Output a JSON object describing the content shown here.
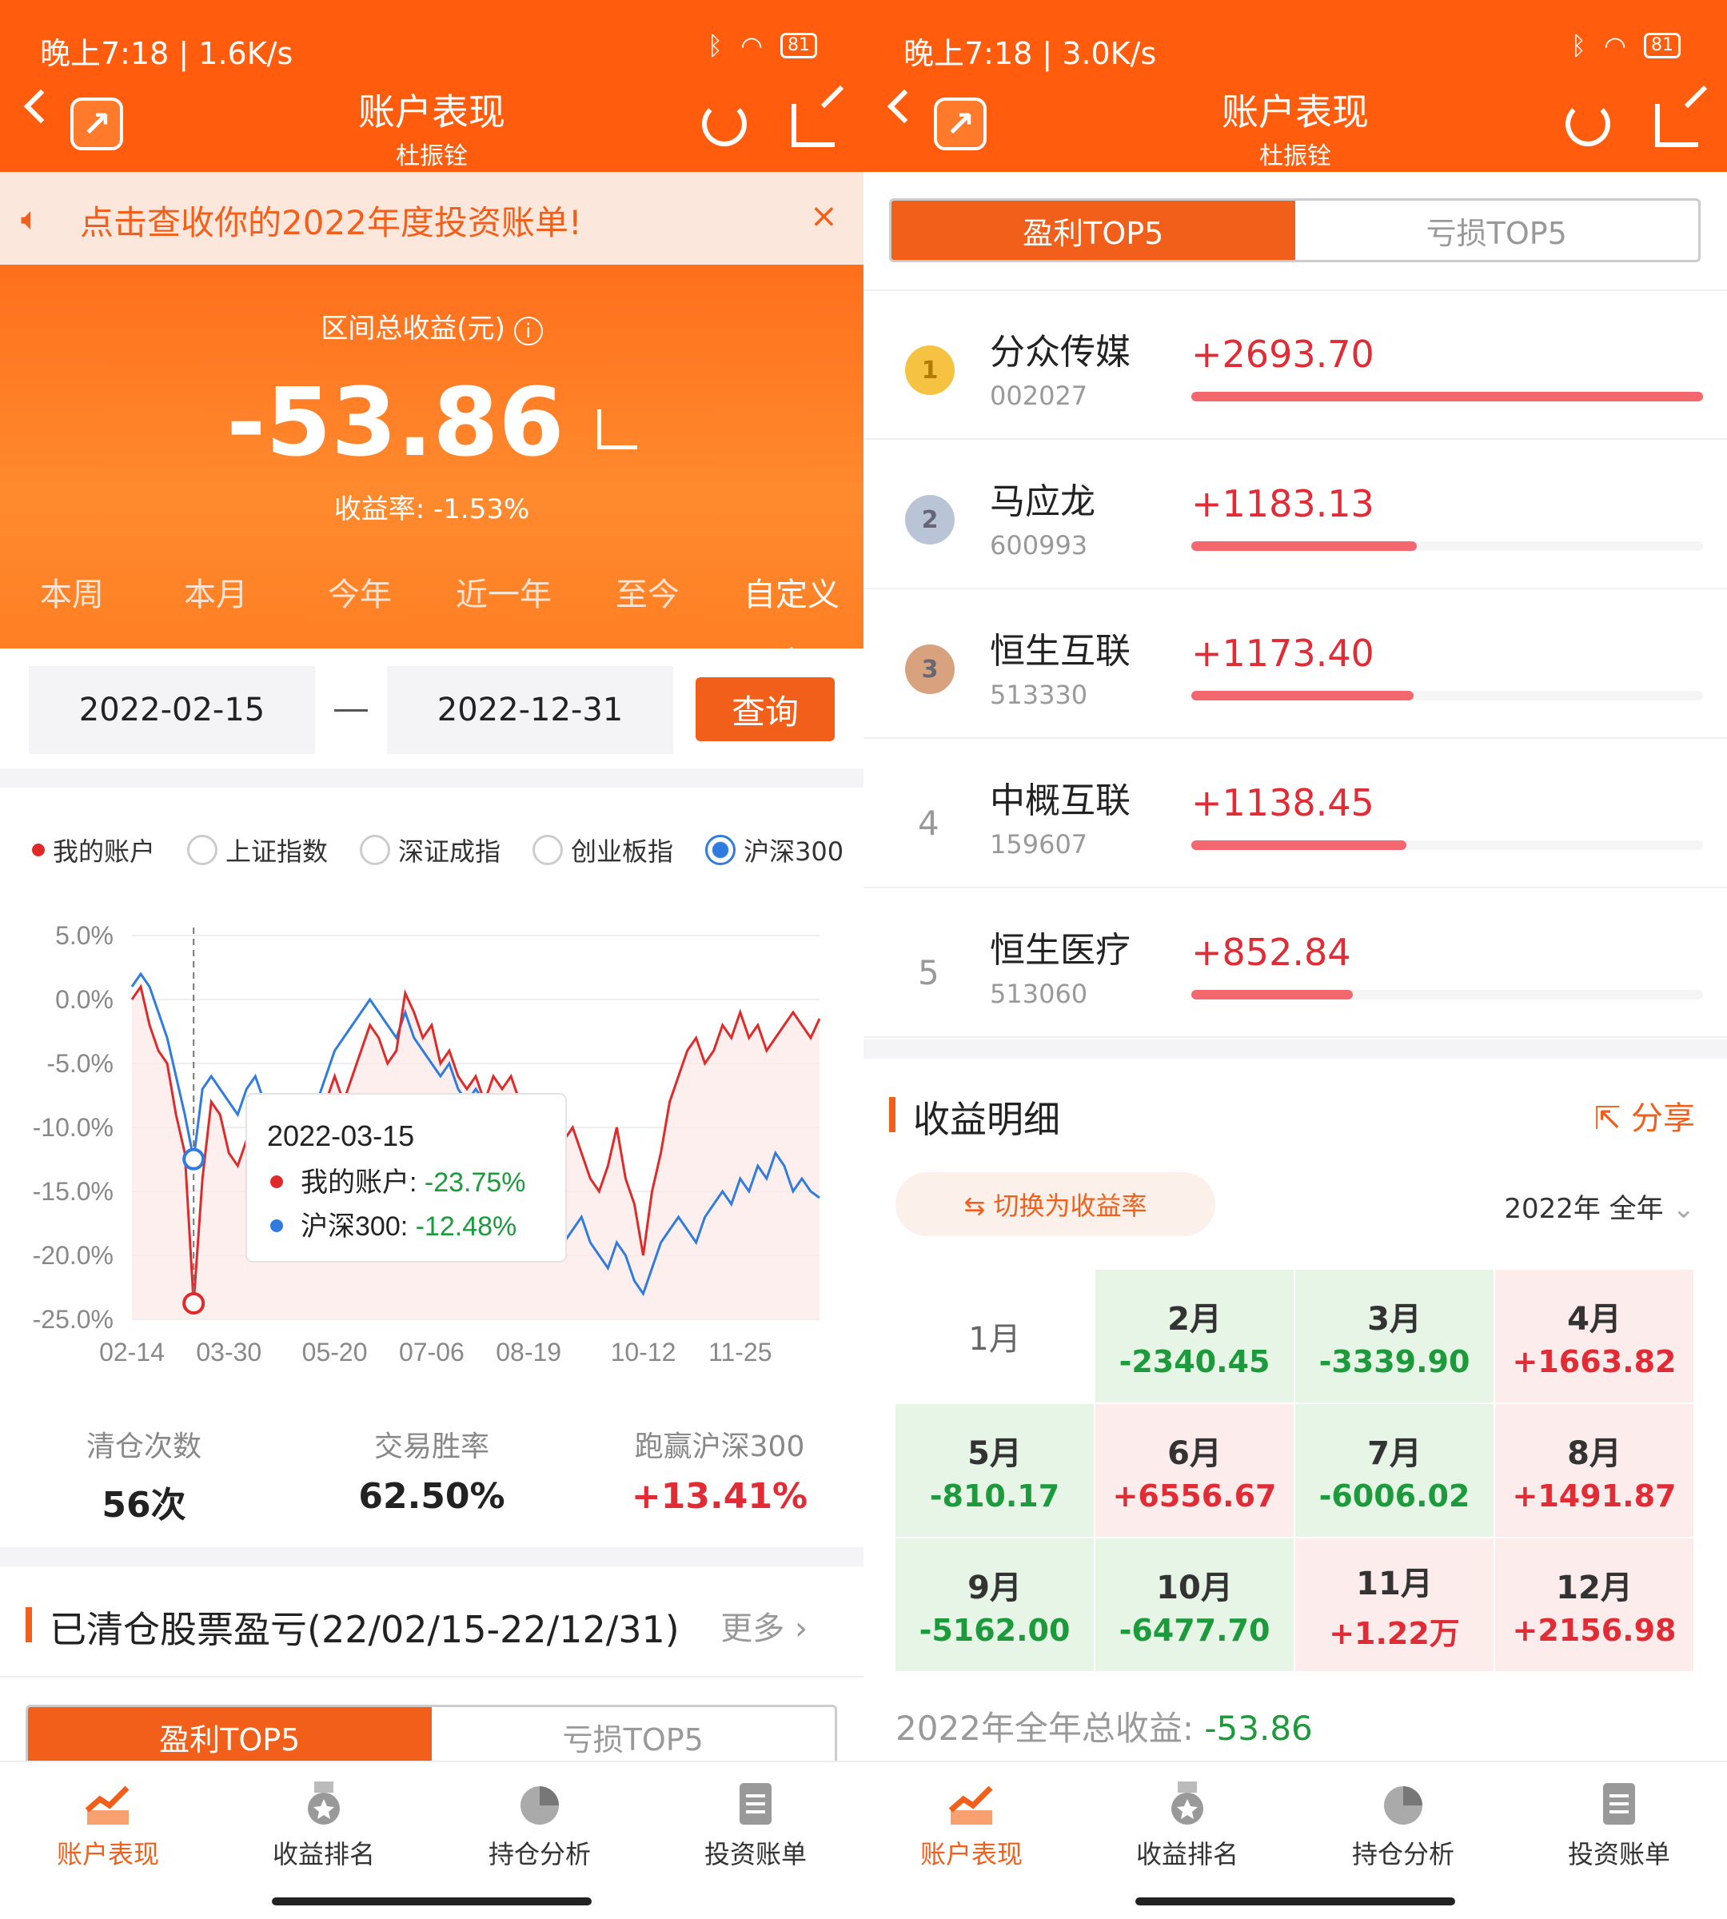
{
  "left": {
    "status": {
      "time_speed": "晚上7:18 | 1.6K/s",
      "battery": "81"
    },
    "header": {
      "title": "账户表现",
      "subtitle": "杜振铨"
    },
    "banner": {
      "text": "点击查收你的2022年度投资账单!",
      "close": "×"
    },
    "hero": {
      "label": "区间总收益(元)",
      "value": "-53.86",
      "rate": "收益率: -1.53%"
    },
    "period_tabs": [
      "本周",
      "本月",
      "今年",
      "近一年",
      "至今",
      "自定义"
    ],
    "period_active": 5,
    "date_range": {
      "start": "2022-02-15",
      "end": "2022-12-31",
      "query_label": "查询"
    },
    "legend": [
      {
        "label": "我的账户",
        "type": "dot"
      },
      {
        "label": "上证指数",
        "type": "radio",
        "checked": false
      },
      {
        "label": "深证成指",
        "type": "radio",
        "checked": false
      },
      {
        "label": "创业板指",
        "type": "radio",
        "checked": false
      },
      {
        "label": "沪深300",
        "type": "radio",
        "checked": true
      }
    ],
    "tooltip": {
      "date": "2022-03-15",
      "mine_label": "我的账户: ",
      "mine_value": "-23.75%",
      "idx_label": "沪深300: ",
      "idx_value": "-12.48%"
    },
    "stats": [
      {
        "label": "清仓次数",
        "value": "56次"
      },
      {
        "label": "交易胜率",
        "value": "62.50%"
      },
      {
        "label": "跑赢沪深300",
        "value": "+13.41%"
      }
    ],
    "cleared_title": "已清仓股票盈亏(22/02/15-22/12/31)",
    "more": "更多",
    "seg": [
      "盈利TOP5",
      "亏损TOP5"
    ]
  },
  "right": {
    "status": {
      "time_speed": "晚上7:18 | 3.0K/s",
      "battery": "81"
    },
    "header": {
      "title": "账户表现",
      "subtitle": "杜振铨"
    },
    "seg": [
      "盈利TOP5",
      "亏损TOP5"
    ],
    "top5": [
      {
        "rank": "1",
        "name": "分众传媒",
        "code": "002027",
        "value": "+2693.70",
        "fill": 1.0
      },
      {
        "rank": "2",
        "name": "马应龙",
        "code": "600993",
        "value": "+1183.13",
        "fill": 0.44
      },
      {
        "rank": "3",
        "name": "恒生互联",
        "code": "513330",
        "value": "+1173.40",
        "fill": 0.435
      },
      {
        "rank": "4",
        "name": "中概互联",
        "code": "159607",
        "value": "+1138.45",
        "fill": 0.42
      },
      {
        "rank": "5",
        "name": "恒生医疗",
        "code": "513060",
        "value": "+852.84",
        "fill": 0.315
      }
    ],
    "detail_title": "收益明细",
    "share_label": "分享",
    "switch_label": "⇆ 切换为收益率",
    "year_select": "2022年 全年",
    "months": [
      {
        "m": "1月",
        "v": "",
        "t": "e"
      },
      {
        "m": "2月",
        "v": "-2340.45",
        "t": "g"
      },
      {
        "m": "3月",
        "v": "-3339.90",
        "t": "g"
      },
      {
        "m": "4月",
        "v": "+1663.82",
        "t": "r"
      },
      {
        "m": "5月",
        "v": "-810.17",
        "t": "g"
      },
      {
        "m": "6月",
        "v": "+6556.67",
        "t": "r"
      },
      {
        "m": "7月",
        "v": "-6006.02",
        "t": "g"
      },
      {
        "m": "8月",
        "v": "+1491.87",
        "t": "r"
      },
      {
        "m": "9月",
        "v": "-5162.00",
        "t": "g"
      },
      {
        "m": "10月",
        "v": "-6477.70",
        "t": "g"
      },
      {
        "m": "11月",
        "v": "+1.22万",
        "t": "r"
      },
      {
        "m": "12月",
        "v": "+2156.98",
        "t": "r"
      }
    ],
    "total_label": "2022年全年总收益: ",
    "total_value": "-53.86"
  },
  "nav": [
    {
      "label": "账户表现",
      "icon": "chart-trend-icon"
    },
    {
      "label": "收益排名",
      "icon": "medal-icon"
    },
    {
      "label": "持仓分析",
      "icon": "pie-icon"
    },
    {
      "label": "投资账单",
      "icon": "document-icon"
    }
  ],
  "colors": {
    "brand": "#ff5d0d",
    "accent": "#f25f1a",
    "red": "#e12c36",
    "green": "#1d9a3c",
    "blue": "#2f7be0"
  },
  "chart_data": {
    "type": "line",
    "x": [
      "02-14",
      "02-18",
      "02-22",
      "02-26",
      "03-02",
      "03-06",
      "03-10",
      "03-15",
      "03-18",
      "03-22",
      "03-26",
      "03-30",
      "04-04",
      "04-08",
      "04-12",
      "04-16",
      "04-20",
      "04-24",
      "04-28",
      "05-02",
      "05-06",
      "05-10",
      "05-14",
      "05-20",
      "05-24",
      "05-28",
      "06-01",
      "06-05",
      "06-09",
      "06-13",
      "06-17",
      "06-21",
      "06-25",
      "07-01",
      "07-06",
      "07-10",
      "07-14",
      "07-18",
      "07-22",
      "07-26",
      "07-30",
      "08-03",
      "08-07",
      "08-11",
      "08-15",
      "08-19",
      "08-23",
      "08-27",
      "08-31",
      "09-04",
      "09-08",
      "09-12",
      "09-16",
      "09-20",
      "09-24",
      "09-28",
      "10-04",
      "10-08",
      "10-12",
      "10-16",
      "10-20",
      "10-24",
      "10-28",
      "11-01",
      "11-05",
      "11-09",
      "11-13",
      "11-17",
      "11-21",
      "11-25",
      "11-29",
      "12-03",
      "12-07",
      "12-11",
      "12-15",
      "12-19",
      "12-23",
      "12-27",
      "12-31"
    ],
    "xticks": [
      "02-14",
      "03-30",
      "05-20",
      "07-06",
      "08-19",
      "10-12",
      "11-25"
    ],
    "yticks": [
      "5.0%",
      "0.0%",
      "-5.0%",
      "-10.0%",
      "-15.0%",
      "-20.0%",
      "-25.0%"
    ],
    "ylim": [
      -25,
      5
    ],
    "series": [
      {
        "name": "我的账户",
        "values": [
          0,
          1,
          -2,
          -4,
          -5,
          -9,
          -12,
          -23.75,
          -14,
          -8,
          -9,
          -12,
          -13,
          -11,
          -10,
          -12,
          -14,
          -13,
          -15,
          -16,
          -12,
          -11,
          -8,
          -6,
          -8,
          -6,
          -4,
          -2,
          -3,
          -5,
          -4,
          0.5,
          -1,
          -3,
          -2,
          -5,
          -4,
          -6,
          -7,
          -6,
          -8,
          -6,
          -7,
          -6,
          -8,
          -9,
          -10,
          -12,
          -13,
          -11,
          -10,
          -12,
          -14,
          -15,
          -13,
          -10,
          -14,
          -16,
          -20,
          -15,
          -12,
          -8,
          -6,
          -4,
          -3,
          -5,
          -4,
          -2,
          -3,
          -1,
          -3,
          -2,
          -4,
          -3,
          -2,
          -1,
          -2,
          -3,
          -1.5
        ]
      },
      {
        "name": "沪深300",
        "values": [
          1,
          2,
          1,
          -1,
          -3,
          -6,
          -9,
          -12.48,
          -7,
          -6,
          -7,
          -8,
          -9,
          -7,
          -6,
          -8,
          -10,
          -9,
          -11,
          -12,
          -10,
          -8,
          -6,
          -4,
          -3,
          -2,
          -1,
          0,
          -1,
          -2,
          -3,
          -1,
          -3,
          -4,
          -5,
          -6,
          -5,
          -7,
          -8,
          -7,
          -8,
          -9,
          -10,
          -11,
          -12,
          -13,
          -14,
          -16,
          -17,
          -19,
          -18,
          -17,
          -19,
          -20,
          -21,
          -19,
          -20,
          -22,
          -23,
          -21,
          -19,
          -18,
          -17,
          -18,
          -19,
          -17,
          -16,
          -15,
          -16,
          -14,
          -15,
          -13,
          -14,
          -12,
          -13,
          -15,
          -14,
          -15,
          -15.5
        ]
      }
    ]
  }
}
